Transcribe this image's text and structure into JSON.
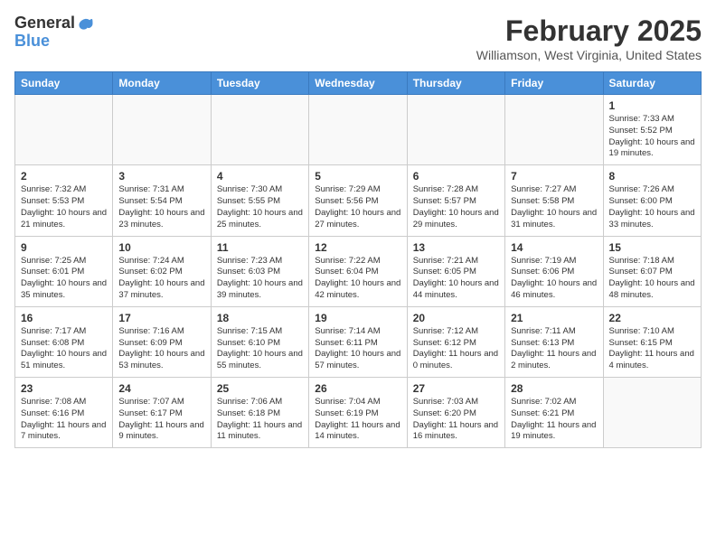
{
  "header": {
    "logo_general": "General",
    "logo_blue": "Blue",
    "month_year": "February 2025",
    "location": "Williamson, West Virginia, United States"
  },
  "days_of_week": [
    "Sunday",
    "Monday",
    "Tuesday",
    "Wednesday",
    "Thursday",
    "Friday",
    "Saturday"
  ],
  "weeks": [
    [
      {
        "day": "",
        "info": ""
      },
      {
        "day": "",
        "info": ""
      },
      {
        "day": "",
        "info": ""
      },
      {
        "day": "",
        "info": ""
      },
      {
        "day": "",
        "info": ""
      },
      {
        "day": "",
        "info": ""
      },
      {
        "day": "1",
        "info": "Sunrise: 7:33 AM\nSunset: 5:52 PM\nDaylight: 10 hours and 19 minutes."
      }
    ],
    [
      {
        "day": "2",
        "info": "Sunrise: 7:32 AM\nSunset: 5:53 PM\nDaylight: 10 hours and 21 minutes."
      },
      {
        "day": "3",
        "info": "Sunrise: 7:31 AM\nSunset: 5:54 PM\nDaylight: 10 hours and 23 minutes."
      },
      {
        "day": "4",
        "info": "Sunrise: 7:30 AM\nSunset: 5:55 PM\nDaylight: 10 hours and 25 minutes."
      },
      {
        "day": "5",
        "info": "Sunrise: 7:29 AM\nSunset: 5:56 PM\nDaylight: 10 hours and 27 minutes."
      },
      {
        "day": "6",
        "info": "Sunrise: 7:28 AM\nSunset: 5:57 PM\nDaylight: 10 hours and 29 minutes."
      },
      {
        "day": "7",
        "info": "Sunrise: 7:27 AM\nSunset: 5:58 PM\nDaylight: 10 hours and 31 minutes."
      },
      {
        "day": "8",
        "info": "Sunrise: 7:26 AM\nSunset: 6:00 PM\nDaylight: 10 hours and 33 minutes."
      }
    ],
    [
      {
        "day": "9",
        "info": "Sunrise: 7:25 AM\nSunset: 6:01 PM\nDaylight: 10 hours and 35 minutes."
      },
      {
        "day": "10",
        "info": "Sunrise: 7:24 AM\nSunset: 6:02 PM\nDaylight: 10 hours and 37 minutes."
      },
      {
        "day": "11",
        "info": "Sunrise: 7:23 AM\nSunset: 6:03 PM\nDaylight: 10 hours and 39 minutes."
      },
      {
        "day": "12",
        "info": "Sunrise: 7:22 AM\nSunset: 6:04 PM\nDaylight: 10 hours and 42 minutes."
      },
      {
        "day": "13",
        "info": "Sunrise: 7:21 AM\nSunset: 6:05 PM\nDaylight: 10 hours and 44 minutes."
      },
      {
        "day": "14",
        "info": "Sunrise: 7:19 AM\nSunset: 6:06 PM\nDaylight: 10 hours and 46 minutes."
      },
      {
        "day": "15",
        "info": "Sunrise: 7:18 AM\nSunset: 6:07 PM\nDaylight: 10 hours and 48 minutes."
      }
    ],
    [
      {
        "day": "16",
        "info": "Sunrise: 7:17 AM\nSunset: 6:08 PM\nDaylight: 10 hours and 51 minutes."
      },
      {
        "day": "17",
        "info": "Sunrise: 7:16 AM\nSunset: 6:09 PM\nDaylight: 10 hours and 53 minutes."
      },
      {
        "day": "18",
        "info": "Sunrise: 7:15 AM\nSunset: 6:10 PM\nDaylight: 10 hours and 55 minutes."
      },
      {
        "day": "19",
        "info": "Sunrise: 7:14 AM\nSunset: 6:11 PM\nDaylight: 10 hours and 57 minutes."
      },
      {
        "day": "20",
        "info": "Sunrise: 7:12 AM\nSunset: 6:12 PM\nDaylight: 11 hours and 0 minutes."
      },
      {
        "day": "21",
        "info": "Sunrise: 7:11 AM\nSunset: 6:13 PM\nDaylight: 11 hours and 2 minutes."
      },
      {
        "day": "22",
        "info": "Sunrise: 7:10 AM\nSunset: 6:15 PM\nDaylight: 11 hours and 4 minutes."
      }
    ],
    [
      {
        "day": "23",
        "info": "Sunrise: 7:08 AM\nSunset: 6:16 PM\nDaylight: 11 hours and 7 minutes."
      },
      {
        "day": "24",
        "info": "Sunrise: 7:07 AM\nSunset: 6:17 PM\nDaylight: 11 hours and 9 minutes."
      },
      {
        "day": "25",
        "info": "Sunrise: 7:06 AM\nSunset: 6:18 PM\nDaylight: 11 hours and 11 minutes."
      },
      {
        "day": "26",
        "info": "Sunrise: 7:04 AM\nSunset: 6:19 PM\nDaylight: 11 hours and 14 minutes."
      },
      {
        "day": "27",
        "info": "Sunrise: 7:03 AM\nSunset: 6:20 PM\nDaylight: 11 hours and 16 minutes."
      },
      {
        "day": "28",
        "info": "Sunrise: 7:02 AM\nSunset: 6:21 PM\nDaylight: 11 hours and 19 minutes."
      },
      {
        "day": "",
        "info": ""
      }
    ]
  ]
}
